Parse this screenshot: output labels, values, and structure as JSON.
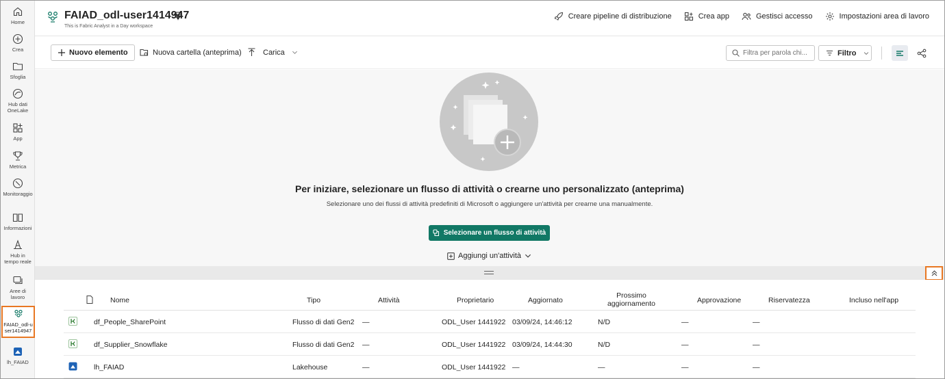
{
  "rail": {
    "items": [
      {
        "label": "Home"
      },
      {
        "label": "Crea"
      },
      {
        "label": "Sfoglia"
      },
      {
        "label": "Hub dati OneLake"
      },
      {
        "label": "App"
      },
      {
        "label": "Metrica"
      },
      {
        "label": "Monitoraggio"
      },
      {
        "label": "Informazioni"
      },
      {
        "label": "Hub in tempo reale"
      },
      {
        "label": "Aree di lavoro"
      },
      {
        "label": "FAIAD_odl-user1414947"
      },
      {
        "label": "lh_FAIAD"
      }
    ],
    "active_border_color": "#e87722"
  },
  "header": {
    "title": "FAIAD_odl-user1414947",
    "subtitle": "This is Fabric Analyst in a Day workspace",
    "actions": [
      {
        "label": "Creare pipeline di distribuzione",
        "icon": "rocket-icon"
      },
      {
        "label": "Crea app",
        "icon": "app-icon"
      },
      {
        "label": "Gestisci accesso",
        "icon": "people-icon"
      },
      {
        "label": "Impostazioni area di lavoro",
        "icon": "gear-icon"
      }
    ]
  },
  "toolbar": {
    "new_item": "Nuovo elemento",
    "new_folder": "Nuova cartella (anteprima)",
    "upload": "Carica",
    "search_placeholder": "Filtra per parola chi...",
    "filter": "Filtro"
  },
  "empty_state": {
    "title": "Per iniziare, selezionare un flusso di attività o crearne uno personalizzato (anteprima)",
    "subtitle": "Selezionare uno dei flussi di attività predefiniti di Microsoft o aggiungere un'attività per crearne una manualmente.",
    "primary_button": "Selezionare un flusso di attività",
    "add_activity": "Aggiungi un'attività",
    "primary_color": "#117865"
  },
  "table": {
    "columns": {
      "name": "Nome",
      "type": "Tipo",
      "activity": "Attività",
      "owner": "Proprietario",
      "updated": "Aggiornato",
      "next_refresh": "Prossimo aggiornamento",
      "approval": "Approvazione",
      "sensitivity": "Riservatezza",
      "in_app": "Incluso nell'app"
    },
    "rows": [
      {
        "name": "df_People_SharePoint",
        "type": "Flusso di dati Gen2",
        "activity": "—",
        "owner": "ODL_User 1441922",
        "updated": "03/09/24, 14:46:12",
        "next_refresh": "N/D",
        "approval": "—",
        "sensitivity": "—",
        "icon": "dataflow-icon"
      },
      {
        "name": "df_Supplier_Snowflake",
        "type": "Flusso di dati Gen2",
        "activity": "—",
        "owner": "ODL_User 1441922",
        "updated": "03/09/24, 14:44:30",
        "next_refresh": "N/D",
        "approval": "—",
        "sensitivity": "—",
        "icon": "dataflow-icon"
      },
      {
        "name": "lh_FAIAD",
        "type": "Lakehouse",
        "activity": "—",
        "owner": "ODL_User 1441922",
        "updated": "—",
        "next_refresh": "—",
        "approval": "—",
        "sensitivity": "—",
        "icon": "lakehouse-icon"
      }
    ]
  }
}
